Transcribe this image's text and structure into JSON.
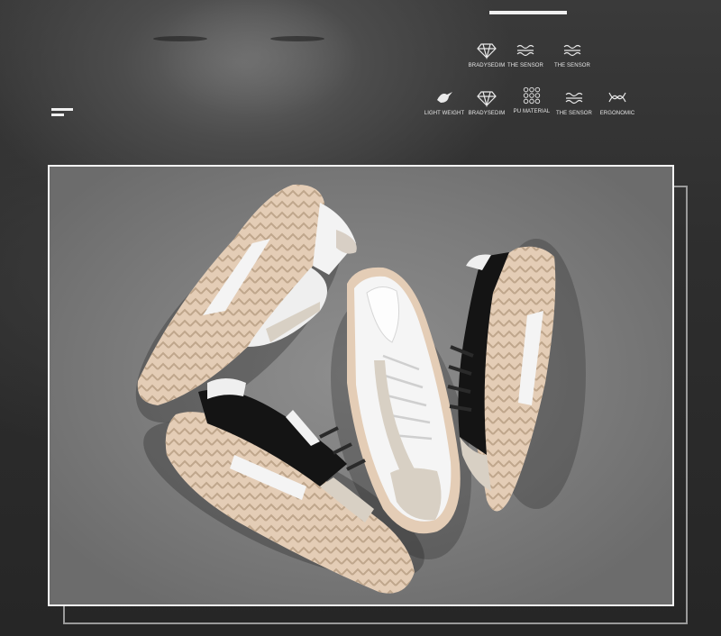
{
  "features_top": [
    {
      "icon": "diamond-icon",
      "label": "BRADYSEDIM"
    },
    {
      "icon": "sensor-wave-icon",
      "label": "THE SENSOR"
    },
    {
      "icon": "sensor-wave-icon",
      "label": "THE SENSOR"
    }
  ],
  "features_bottom": [
    {
      "icon": "bird-icon",
      "label": "LIGHT WEIGHT"
    },
    {
      "icon": "diamond-icon",
      "label": "BRADYSEDIM"
    },
    {
      "icon": "grid-material-icon",
      "label": "PU MATERIAL"
    },
    {
      "icon": "sensor-wave-icon",
      "label": "THE SENSOR"
    },
    {
      "icon": "dna-icon",
      "label": "ERGONOMIC"
    }
  ],
  "colors": {
    "background": "#2b2b2b",
    "frame": "#f4f4f4",
    "sole": "#e4cdb6",
    "leather_black": "#141414",
    "leather_white": "#f2f2f2",
    "suede": "#d8d0c4"
  }
}
